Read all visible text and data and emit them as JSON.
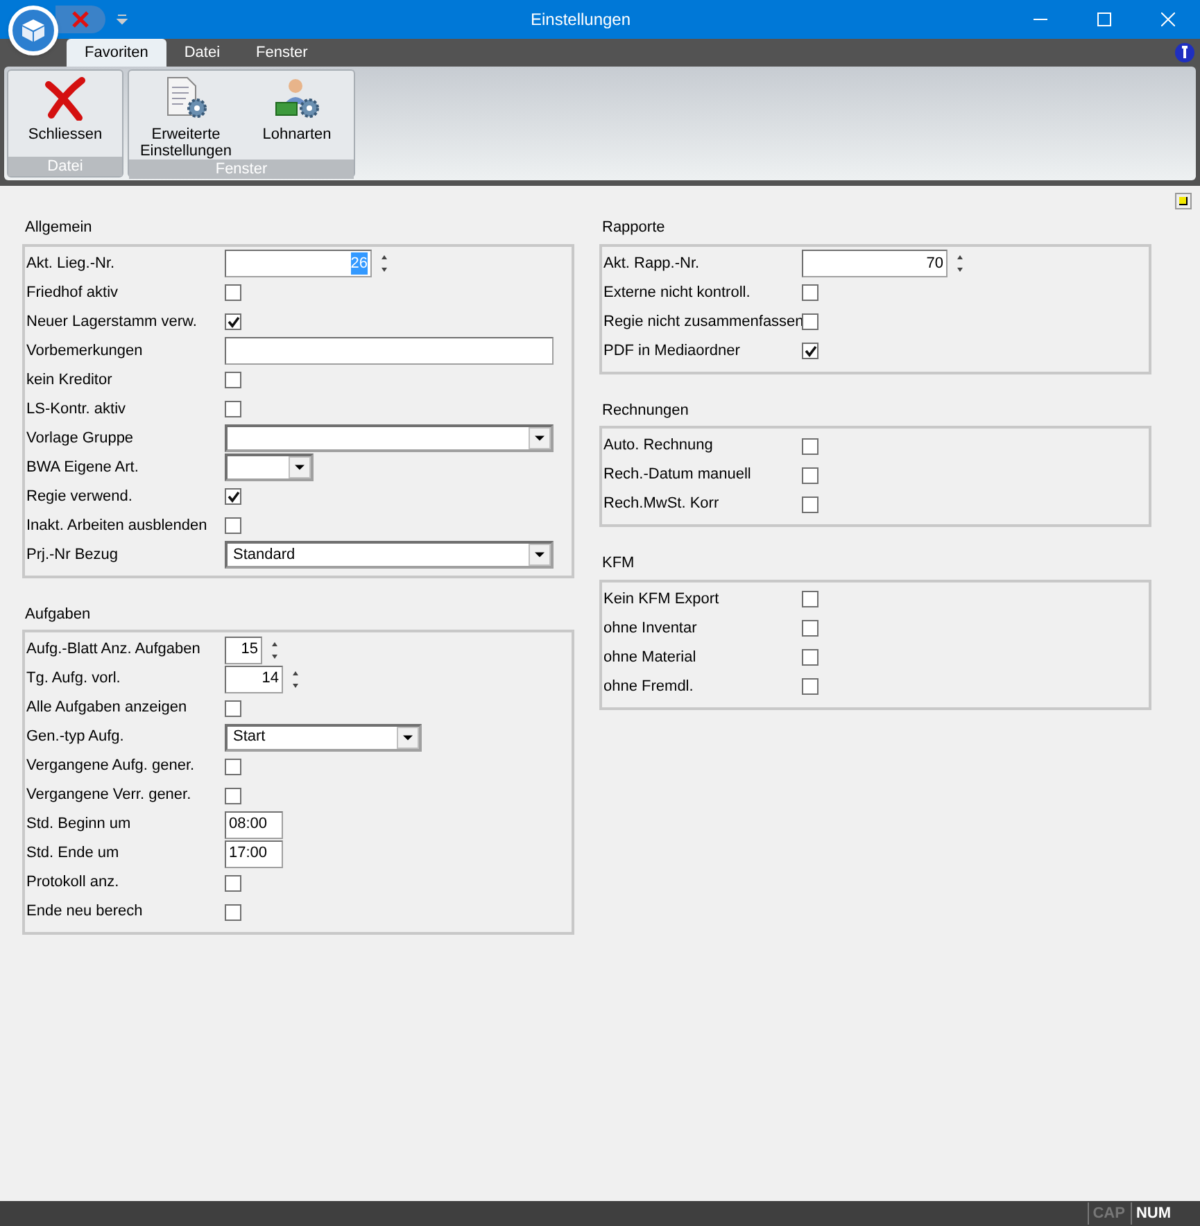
{
  "window": {
    "title": "Einstellungen"
  },
  "ribbon": {
    "tabs": [
      {
        "label": "Favoriten",
        "selected": true
      },
      {
        "label": "Datei",
        "selected": false
      },
      {
        "label": "Fenster",
        "selected": false
      }
    ],
    "groups": [
      {
        "label": "Datei",
        "buttons": [
          {
            "kind": "close",
            "label": "Schliessen"
          }
        ]
      },
      {
        "label": "Fenster",
        "buttons": [
          {
            "kind": "document",
            "label": "Erweiterte Einstellungen"
          },
          {
            "kind": "person",
            "label": "Lohnarten"
          }
        ]
      }
    ]
  },
  "columns": [
    [
      {
        "title": "Allgemein",
        "rows": [
          {
            "label": "Akt. Lieg.-Nr.",
            "kind": "spin",
            "value": "26",
            "selected": true
          },
          {
            "label": "Friedhof aktiv",
            "kind": "checkbox",
            "checked": false
          },
          {
            "label": "Neuer Lagerstamm verw.",
            "kind": "checkbox",
            "checked": true
          },
          {
            "label": "Vorbemerkungen",
            "kind": "text"
          },
          {
            "label": "kein Kreditor",
            "kind": "checkbox",
            "checked": false
          },
          {
            "label": "LS-Kontr. aktiv",
            "kind": "checkbox",
            "checked": false
          },
          {
            "label": "Vorlage Gruppe",
            "kind": "combo"
          },
          {
            "label": "BWA Eigene Art.",
            "kind": "combo"
          },
          {
            "label": "Regie verwend.",
            "kind": "checkbox",
            "checked": true
          },
          {
            "label": "Inakt. Arbeiten ausblenden",
            "kind": "checkbox",
            "checked": false
          },
          {
            "label": "Prj.-Nr Bezug",
            "kind": "combo",
            "value": "Standard"
          }
        ]
      },
      {
        "title": "Aufgaben",
        "rows": [
          {
            "label": "Aufg.-Blatt Anz. Aufgaben",
            "kind": "spin",
            "value": "15",
            "selected": false
          },
          {
            "label": "Tg. Aufg. vorl.",
            "kind": "spin",
            "value": "14",
            "selected": false
          },
          {
            "label": "Alle Aufgaben anzeigen",
            "kind": "checkbox",
            "checked": false
          },
          {
            "label": "Gen.-typ Aufg.",
            "kind": "combo",
            "value": "Start"
          },
          {
            "label": "Vergangene Aufg. gener.",
            "kind": "checkbox",
            "checked": false
          },
          {
            "label": "Vergangene Verr. gener.",
            "kind": "checkbox",
            "checked": false
          },
          {
            "label": "Std. Beginn um",
            "kind": "text",
            "value": "08:00"
          },
          {
            "label": "Std. Ende um",
            "kind": "text",
            "value": "17:00"
          },
          {
            "label": "Protokoll anz.",
            "kind": "checkbox",
            "checked": false
          },
          {
            "label": "Ende neu berech",
            "kind": "checkbox",
            "checked": false
          }
        ]
      }
    ],
    [
      {
        "title": "Rapporte",
        "rows": [
          {
            "label": "Akt. Rapp.-Nr.",
            "kind": "spin",
            "value": "70",
            "selected": false
          },
          {
            "label": "Externe nicht kontroll.",
            "kind": "checkbox",
            "checked": false
          },
          {
            "label": "Regie nicht zusammenfassen",
            "kind": "checkbox",
            "checked": false
          },
          {
            "label": "PDF in Mediaordner",
            "kind": "checkbox",
            "checked": true
          }
        ]
      },
      {
        "title": "Rechnungen",
        "rows": [
          {
            "label": "Auto. Rechnung",
            "kind": "checkbox",
            "checked": false
          },
          {
            "label": "Rech.-Datum manuell",
            "kind": "checkbox",
            "checked": false
          },
          {
            "label": "Rech.MwSt. Korr",
            "kind": "checkbox",
            "checked": false
          }
        ]
      },
      {
        "title": "KFM",
        "rows": [
          {
            "label": "Kein KFM Export",
            "kind": "checkbox",
            "checked": false
          },
          {
            "label": "ohne Inventar",
            "kind": "checkbox",
            "checked": false
          },
          {
            "label": "ohne Material",
            "kind": "checkbox",
            "checked": false
          },
          {
            "label": "ohne Fremdl.",
            "kind": "checkbox",
            "checked": false
          }
        ]
      }
    ]
  ],
  "status_bar": [
    {
      "label": "CAP",
      "on": false
    },
    {
      "label": "NUM",
      "on": true
    }
  ]
}
